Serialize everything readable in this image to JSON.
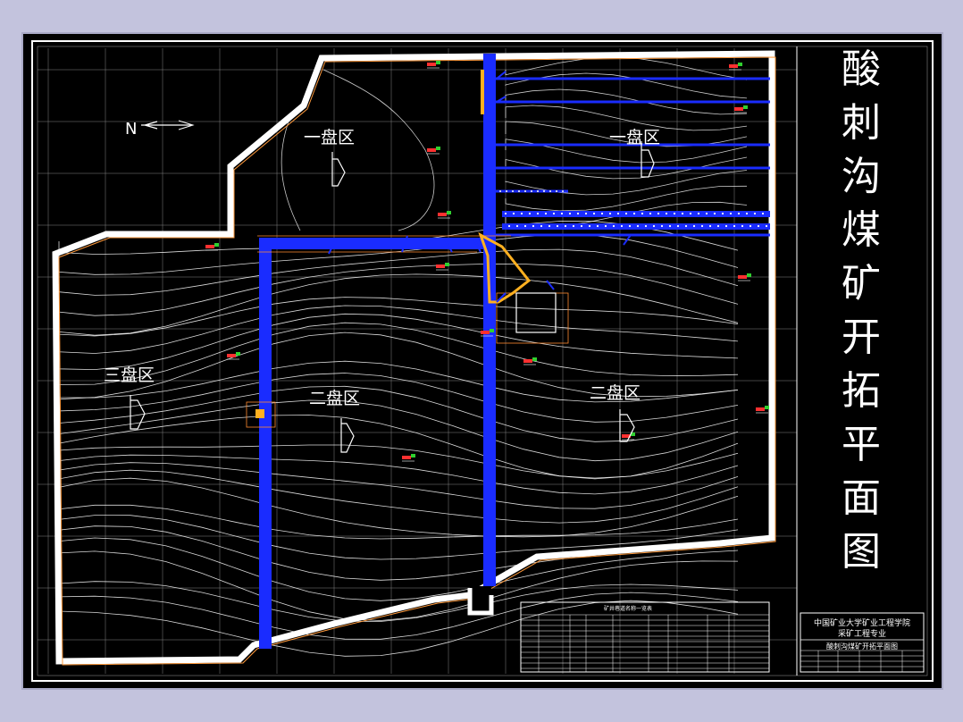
{
  "drawing": {
    "title_chars": [
      "酸",
      "刺",
      "沟",
      "煤",
      "矿",
      "开",
      "拓",
      "平",
      "面",
      "图"
    ],
    "zones": {
      "zone_one_top": "一盘区",
      "zone_one_right": "一盘区",
      "zone_two_center": "二盘区",
      "zone_two_right": "二盘区",
      "zone_three": "三盘区"
    },
    "north_arrow": "N",
    "table_title": "矿井巷道名称一览表",
    "title_block": {
      "school": "中国矿业大学矿业工程学院",
      "major": "采矿工程专业",
      "drawing_name": "酸刺沟煤矿开拓平面图"
    }
  },
  "colors": {
    "background": "#000000",
    "boundary": "#ffffff",
    "roadway": "#1a2cff",
    "shaft": "#ffb020",
    "contour": "#ffffff",
    "grid": "#cfcfcf"
  }
}
